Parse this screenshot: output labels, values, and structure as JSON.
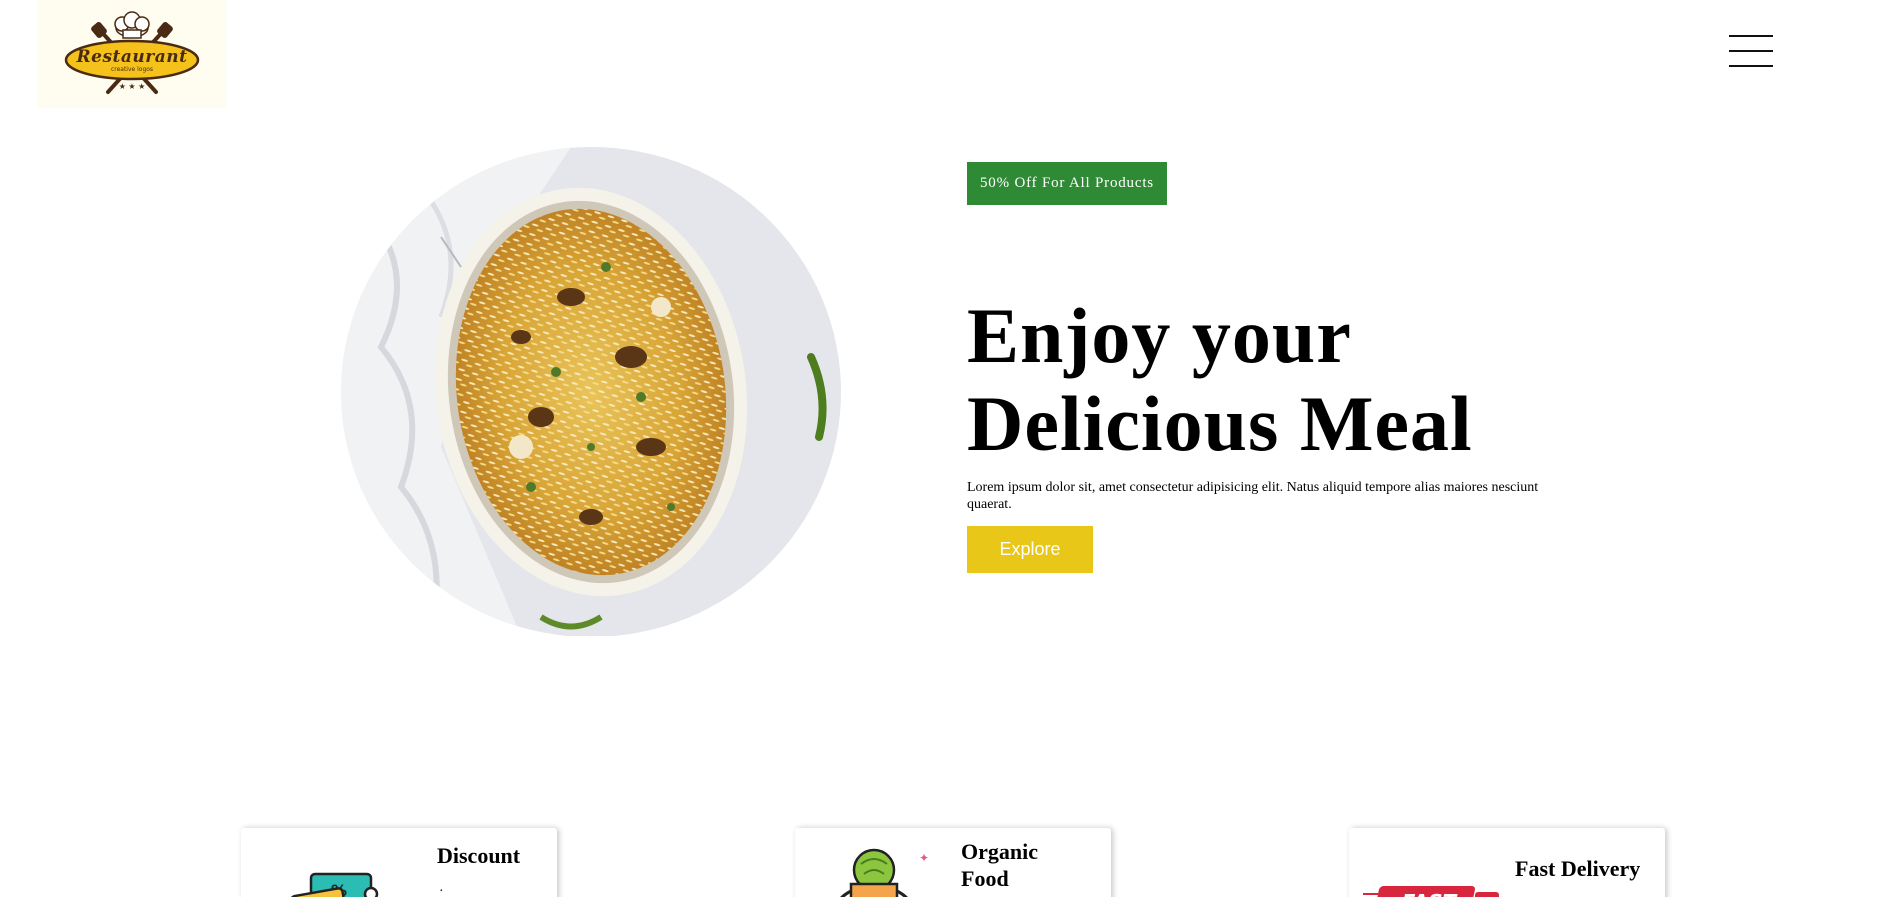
{
  "header": {
    "logo_text": "Restaurant",
    "logo_tagline": "creative logos",
    "logo_icon": "chef-hat-crossed-utensils-icon",
    "menu_icon": "hamburger-menu-icon"
  },
  "hero": {
    "image_icon": "biryani-dish-photo",
    "badge": "50% Off For All Products",
    "title_line1": "Enjoy your",
    "title_line2": "Delicious Meal",
    "description": "Lorem ipsum dolor sit, amet consectetur adipisicing elit. Natus aliquid tempore alias maiores nesciunt quaerat.",
    "button_label": "Explore"
  },
  "features": [
    {
      "title": "Discount",
      "icon": "discount-ticket-icon"
    },
    {
      "title": "Organic Food",
      "icon": "organic-food-basket-icon"
    },
    {
      "title": "Fast Delivery",
      "icon": "fast-delivery-truck-icon"
    }
  ],
  "colors": {
    "badge_green": "#2f8a35",
    "button_yellow": "#e8c718",
    "logo_yellow": "#f4c21b",
    "logo_brown": "#4a2a12"
  }
}
